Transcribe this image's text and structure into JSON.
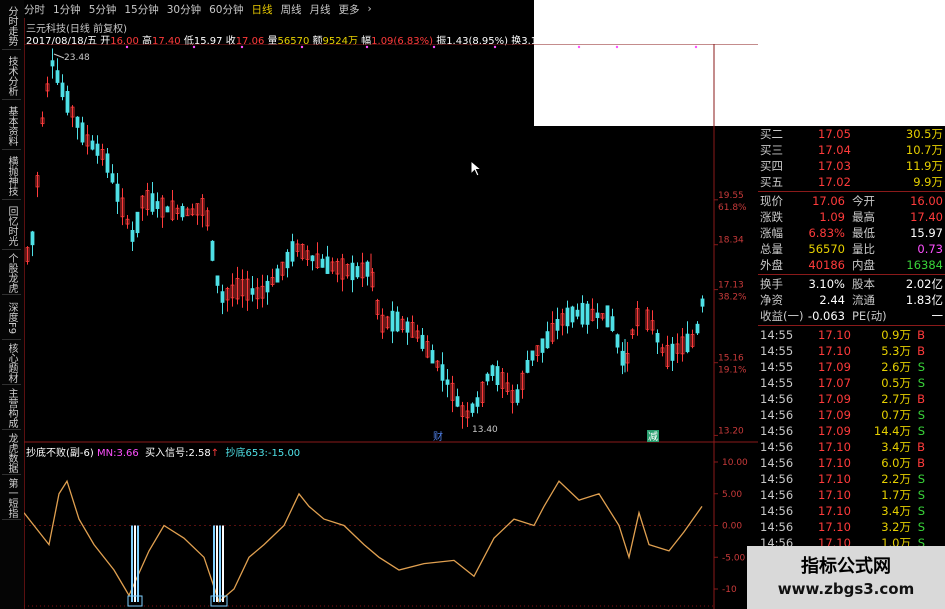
{
  "left_tabs": [
    "分时走势",
    "技术分析",
    "基本资料",
    "横抛神技",
    "回忆时光",
    "个股龙虎",
    "深度F9",
    "核心题材",
    "主营构成",
    "龙虎数据",
    "第一短指"
  ],
  "top_tabs": [
    "分时",
    "1分钟",
    "5分钟",
    "15分钟",
    "30分钟",
    "60分钟",
    "日线",
    "周线",
    "月线",
    "更多",
    "›"
  ],
  "active_tab": "日线",
  "stock_title": "三元科技(日线 前复权)",
  "info": {
    "date": "2017/08/18/五",
    "open_label": "开",
    "open": "16.00",
    "high_label": "高",
    "high": "17.40",
    "low_label": "低",
    "low": "15.97",
    "close_label": "收",
    "close": "17.06",
    "vol_label": "量",
    "vol": "56570",
    "amt_label": "额",
    "amt": "9524万",
    "chg_label": "幅",
    "chg": "1.09(6.83%)",
    "amp_label": "振",
    "amp": "1.43(8.95%)",
    "turn_label": "换",
    "turn": "3.10%",
    "float_label": "流通",
    "float": "1"
  },
  "price_labels": {
    "high_mark": "23.48",
    "low_mark": "13.40",
    "p1": "19.55",
    "p1b": "61.8%",
    "p2": "18.34",
    "p3": "17.13",
    "p3b": "38.2%",
    "p4": "15.16",
    "p4b": "19.1%",
    "p5": "13.20"
  },
  "markers": {
    "m1": "财",
    "m2": "减"
  },
  "indicator": {
    "name": "抄底不败(副-6)",
    "mn_label": "MN:",
    "mn": "3.66",
    "buy_label": "买入信号:",
    "buy": "2.58",
    "bottom_label": "抄底653:",
    "bottom": "-15.00"
  },
  "ind_axis": [
    "10.00",
    "5.00",
    "0.00",
    "-5.00",
    "-10"
  ],
  "orderbook": [
    {
      "label": "买二",
      "price": "17.05",
      "vol": "30.5万"
    },
    {
      "label": "买三",
      "price": "17.04",
      "vol": "10.7万"
    },
    {
      "label": "买四",
      "price": "17.03",
      "vol": "11.9万"
    },
    {
      "label": "买五",
      "price": "17.02",
      "vol": "9.9万"
    }
  ],
  "stats": [
    {
      "l1": "现价",
      "v1": "17.06",
      "l2": "今开",
      "v2": "16.00"
    },
    {
      "l1": "涨跌",
      "v1": "1.09",
      "l2": "最高",
      "v2": "17.40"
    },
    {
      "l1": "涨幅",
      "v1": "6.83%",
      "l2": "最低",
      "v2": "15.97"
    },
    {
      "l1": "总量",
      "v1": "56570",
      "l2": "量比",
      "v2": "0.73"
    },
    {
      "l1": "外盘",
      "v1": "40186",
      "l2": "内盘",
      "v2": "16384"
    }
  ],
  "stats2": [
    {
      "l1": "换手",
      "v1": "3.10%",
      "l2": "股本",
      "v2": "2.02亿"
    },
    {
      "l1": "净资",
      "v1": "2.44",
      "l2": "流通",
      "v2": "1.83亿"
    },
    {
      "l1": "收益(一)",
      "v1": "-0.063",
      "l2": "PE(动)",
      "v2": "一"
    }
  ],
  "ticks": [
    {
      "t": "14:55",
      "p": "17.10",
      "v": "0.9万",
      "s": "B"
    },
    {
      "t": "14:55",
      "p": "17.10",
      "v": "5.3万",
      "s": "B"
    },
    {
      "t": "14:55",
      "p": "17.09",
      "v": "2.6万",
      "s": "S"
    },
    {
      "t": "14:55",
      "p": "17.07",
      "v": "0.5万",
      "s": "S"
    },
    {
      "t": "14:56",
      "p": "17.09",
      "v": "2.7万",
      "s": "B"
    },
    {
      "t": "14:56",
      "p": "17.09",
      "v": "0.7万",
      "s": "S"
    },
    {
      "t": "14:56",
      "p": "17.09",
      "v": "14.4万",
      "s": "S"
    },
    {
      "t": "14:56",
      "p": "17.10",
      "v": "3.4万",
      "s": "B"
    },
    {
      "t": "14:56",
      "p": "17.10",
      "v": "6.0万",
      "s": "B"
    },
    {
      "t": "14:56",
      "p": "17.10",
      "v": "2.2万",
      "s": "S"
    },
    {
      "t": "14:56",
      "p": "17.10",
      "v": "1.7万",
      "s": "S"
    },
    {
      "t": "14:56",
      "p": "17.10",
      "v": "3.4万",
      "s": "S"
    },
    {
      "t": "14:56",
      "p": "17.10",
      "v": "3.2万",
      "s": "S"
    },
    {
      "t": "14:56",
      "p": "17.10",
      "v": "1.0万",
      "s": "S"
    },
    {
      "t": "14:56",
      "p": "17.10",
      "v": "1.0万",
      "s": "S"
    }
  ],
  "watermark": {
    "line1": "指标公式网",
    "line2": "www.zbgs3.com"
  }
}
